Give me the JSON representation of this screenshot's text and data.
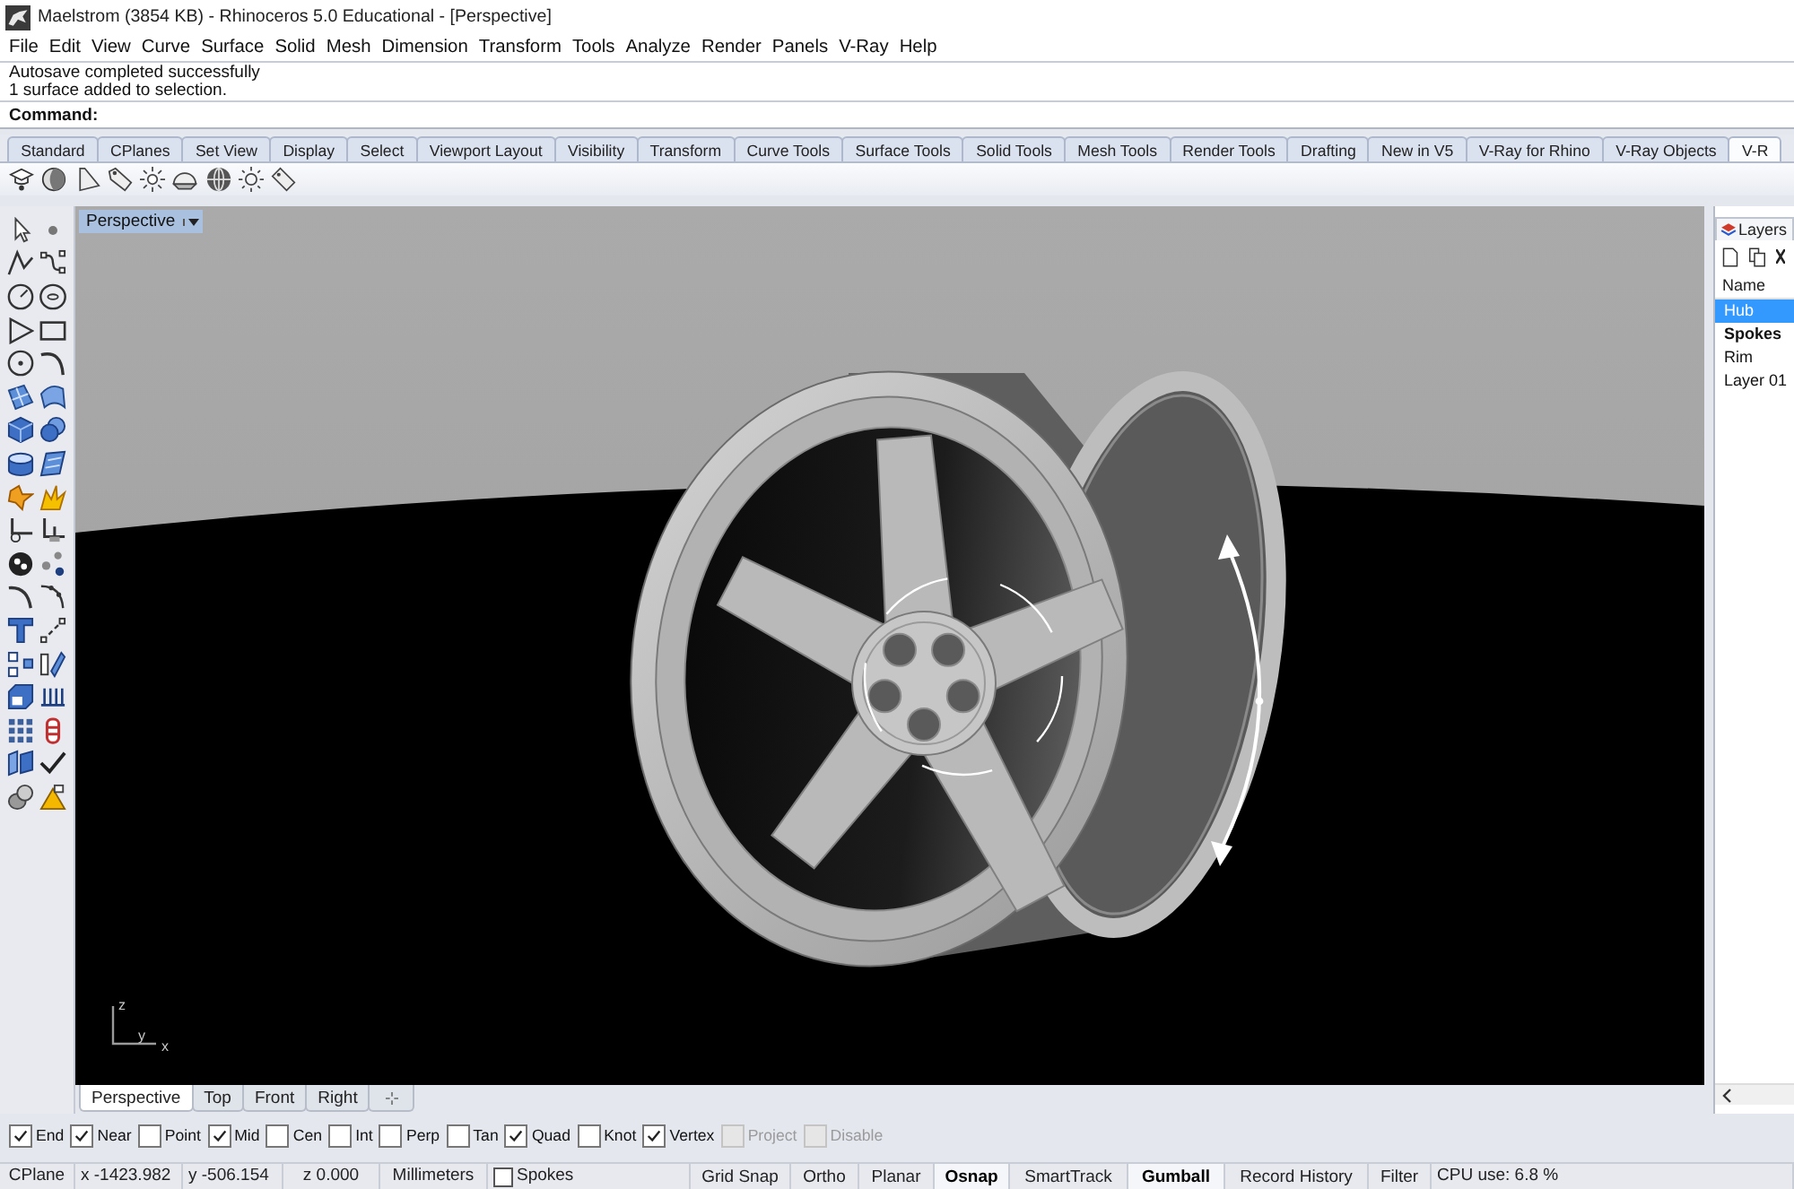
{
  "window": {
    "title": "Maelstrom (3854 KB) - Rhinoceros 5.0 Educational - [Perspective]"
  },
  "menu": [
    "File",
    "Edit",
    "View",
    "Curve",
    "Surface",
    "Solid",
    "Mesh",
    "Dimension",
    "Transform",
    "Tools",
    "Analyze",
    "Render",
    "Panels",
    "V-Ray",
    "Help"
  ],
  "command_history": [
    "Autosave completed successfully",
    "1 surface added to selection."
  ],
  "command_prompt": "Command:",
  "toolbar_tabs": [
    {
      "label": "Standard",
      "selected": false
    },
    {
      "label": "CPlanes",
      "selected": false
    },
    {
      "label": "Set View",
      "selected": false
    },
    {
      "label": "Display",
      "selected": false
    },
    {
      "label": "Select",
      "selected": false
    },
    {
      "label": "Viewport Layout",
      "selected": false
    },
    {
      "label": "Visibility",
      "selected": false
    },
    {
      "label": "Transform",
      "selected": false
    },
    {
      "label": "Curve Tools",
      "selected": false
    },
    {
      "label": "Surface Tools",
      "selected": false
    },
    {
      "label": "Solid Tools",
      "selected": false
    },
    {
      "label": "Mesh Tools",
      "selected": false
    },
    {
      "label": "Render Tools",
      "selected": false
    },
    {
      "label": "Drafting",
      "selected": false
    },
    {
      "label": "New in V5",
      "selected": false
    },
    {
      "label": "V-Ray for Rhino",
      "selected": false
    },
    {
      "label": "V-Ray Objects",
      "selected": false
    },
    {
      "label": "V-R",
      "selected": true
    }
  ],
  "viewport": {
    "label": "Perspective",
    "axis_labels": [
      "z",
      "y",
      "x"
    ]
  },
  "layers_panel": {
    "title": "Layers",
    "column": "Name",
    "layers": [
      {
        "name": "Hub",
        "selected": true,
        "current": false
      },
      {
        "name": "Spokes",
        "selected": false,
        "current": true
      },
      {
        "name": "Rim",
        "selected": false,
        "current": false
      },
      {
        "name": "Layer 01",
        "selected": false,
        "current": false
      }
    ]
  },
  "viewport_tabs": [
    {
      "label": "Perspective",
      "selected": true
    },
    {
      "label": "Top",
      "selected": false
    },
    {
      "label": "Front",
      "selected": false
    },
    {
      "label": "Right",
      "selected": false
    }
  ],
  "osnaps": [
    {
      "label": "End",
      "checked": true,
      "disabled": false
    },
    {
      "label": "Near",
      "checked": true,
      "disabled": false
    },
    {
      "label": "Point",
      "checked": false,
      "disabled": false
    },
    {
      "label": "Mid",
      "checked": true,
      "disabled": false
    },
    {
      "label": "Cen",
      "checked": false,
      "disabled": false
    },
    {
      "label": "Int",
      "checked": false,
      "disabled": false
    },
    {
      "label": "Perp",
      "checked": false,
      "disabled": false
    },
    {
      "label": "Tan",
      "checked": false,
      "disabled": false
    },
    {
      "label": "Quad",
      "checked": true,
      "disabled": false
    },
    {
      "label": "Knot",
      "checked": false,
      "disabled": false
    },
    {
      "label": "Vertex",
      "checked": true,
      "disabled": false
    },
    {
      "label": "Project",
      "checked": false,
      "disabled": true
    },
    {
      "label": "Disable",
      "checked": false,
      "disabled": true
    }
  ],
  "status_bar": {
    "cplane": "CPlane",
    "x": "x -1423.982",
    "y": "y -506.154",
    "z": "z 0.000",
    "units": "Millimeters",
    "layer": "Spokes",
    "toggles": [
      {
        "label": "Grid Snap",
        "on": false
      },
      {
        "label": "Ortho",
        "on": false
      },
      {
        "label": "Planar",
        "on": false
      },
      {
        "label": "Osnap",
        "on": true
      },
      {
        "label": "SmartTrack",
        "on": false
      },
      {
        "label": "Gumball",
        "on": true
      },
      {
        "label": "Record History",
        "on": false
      },
      {
        "label": "Filter",
        "on": false
      }
    ],
    "cpu": "CPU use: 6.8 %"
  }
}
